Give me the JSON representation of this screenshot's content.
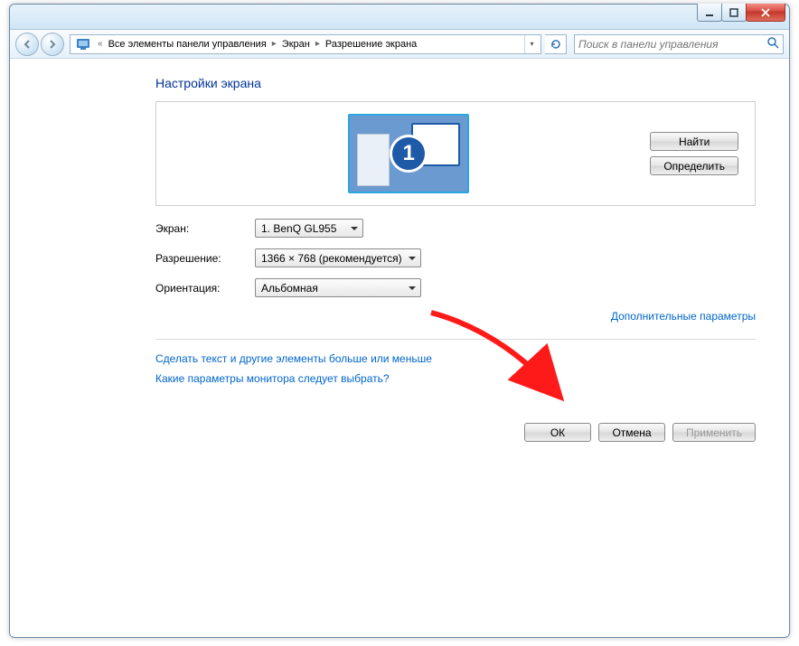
{
  "breadcrumb": {
    "seg1": "Все элементы панели управления",
    "seg2": "Экран",
    "seg3": "Разрешение экрана"
  },
  "search": {
    "placeholder": "Поиск в панели управления"
  },
  "page": {
    "title": "Настройки экрана",
    "monitor_id": "1"
  },
  "preview_buttons": {
    "find": "Найти",
    "identify": "Определить"
  },
  "rows": {
    "display_label": "Экран:",
    "display_value": "1. BenQ GL955",
    "resolution_label": "Разрешение:",
    "resolution_value": "1366 × 768 (рекомендуется)",
    "orientation_label": "Ориентация:",
    "orientation_value": "Альбомная"
  },
  "links": {
    "advanced": "Дополнительные параметры",
    "text_size": "Сделать текст и другие элементы больше или меньше",
    "which_monitor": "Какие параметры монитора следует выбрать?"
  },
  "footer": {
    "ok": "ОК",
    "cancel": "Отмена",
    "apply": "Применить"
  }
}
